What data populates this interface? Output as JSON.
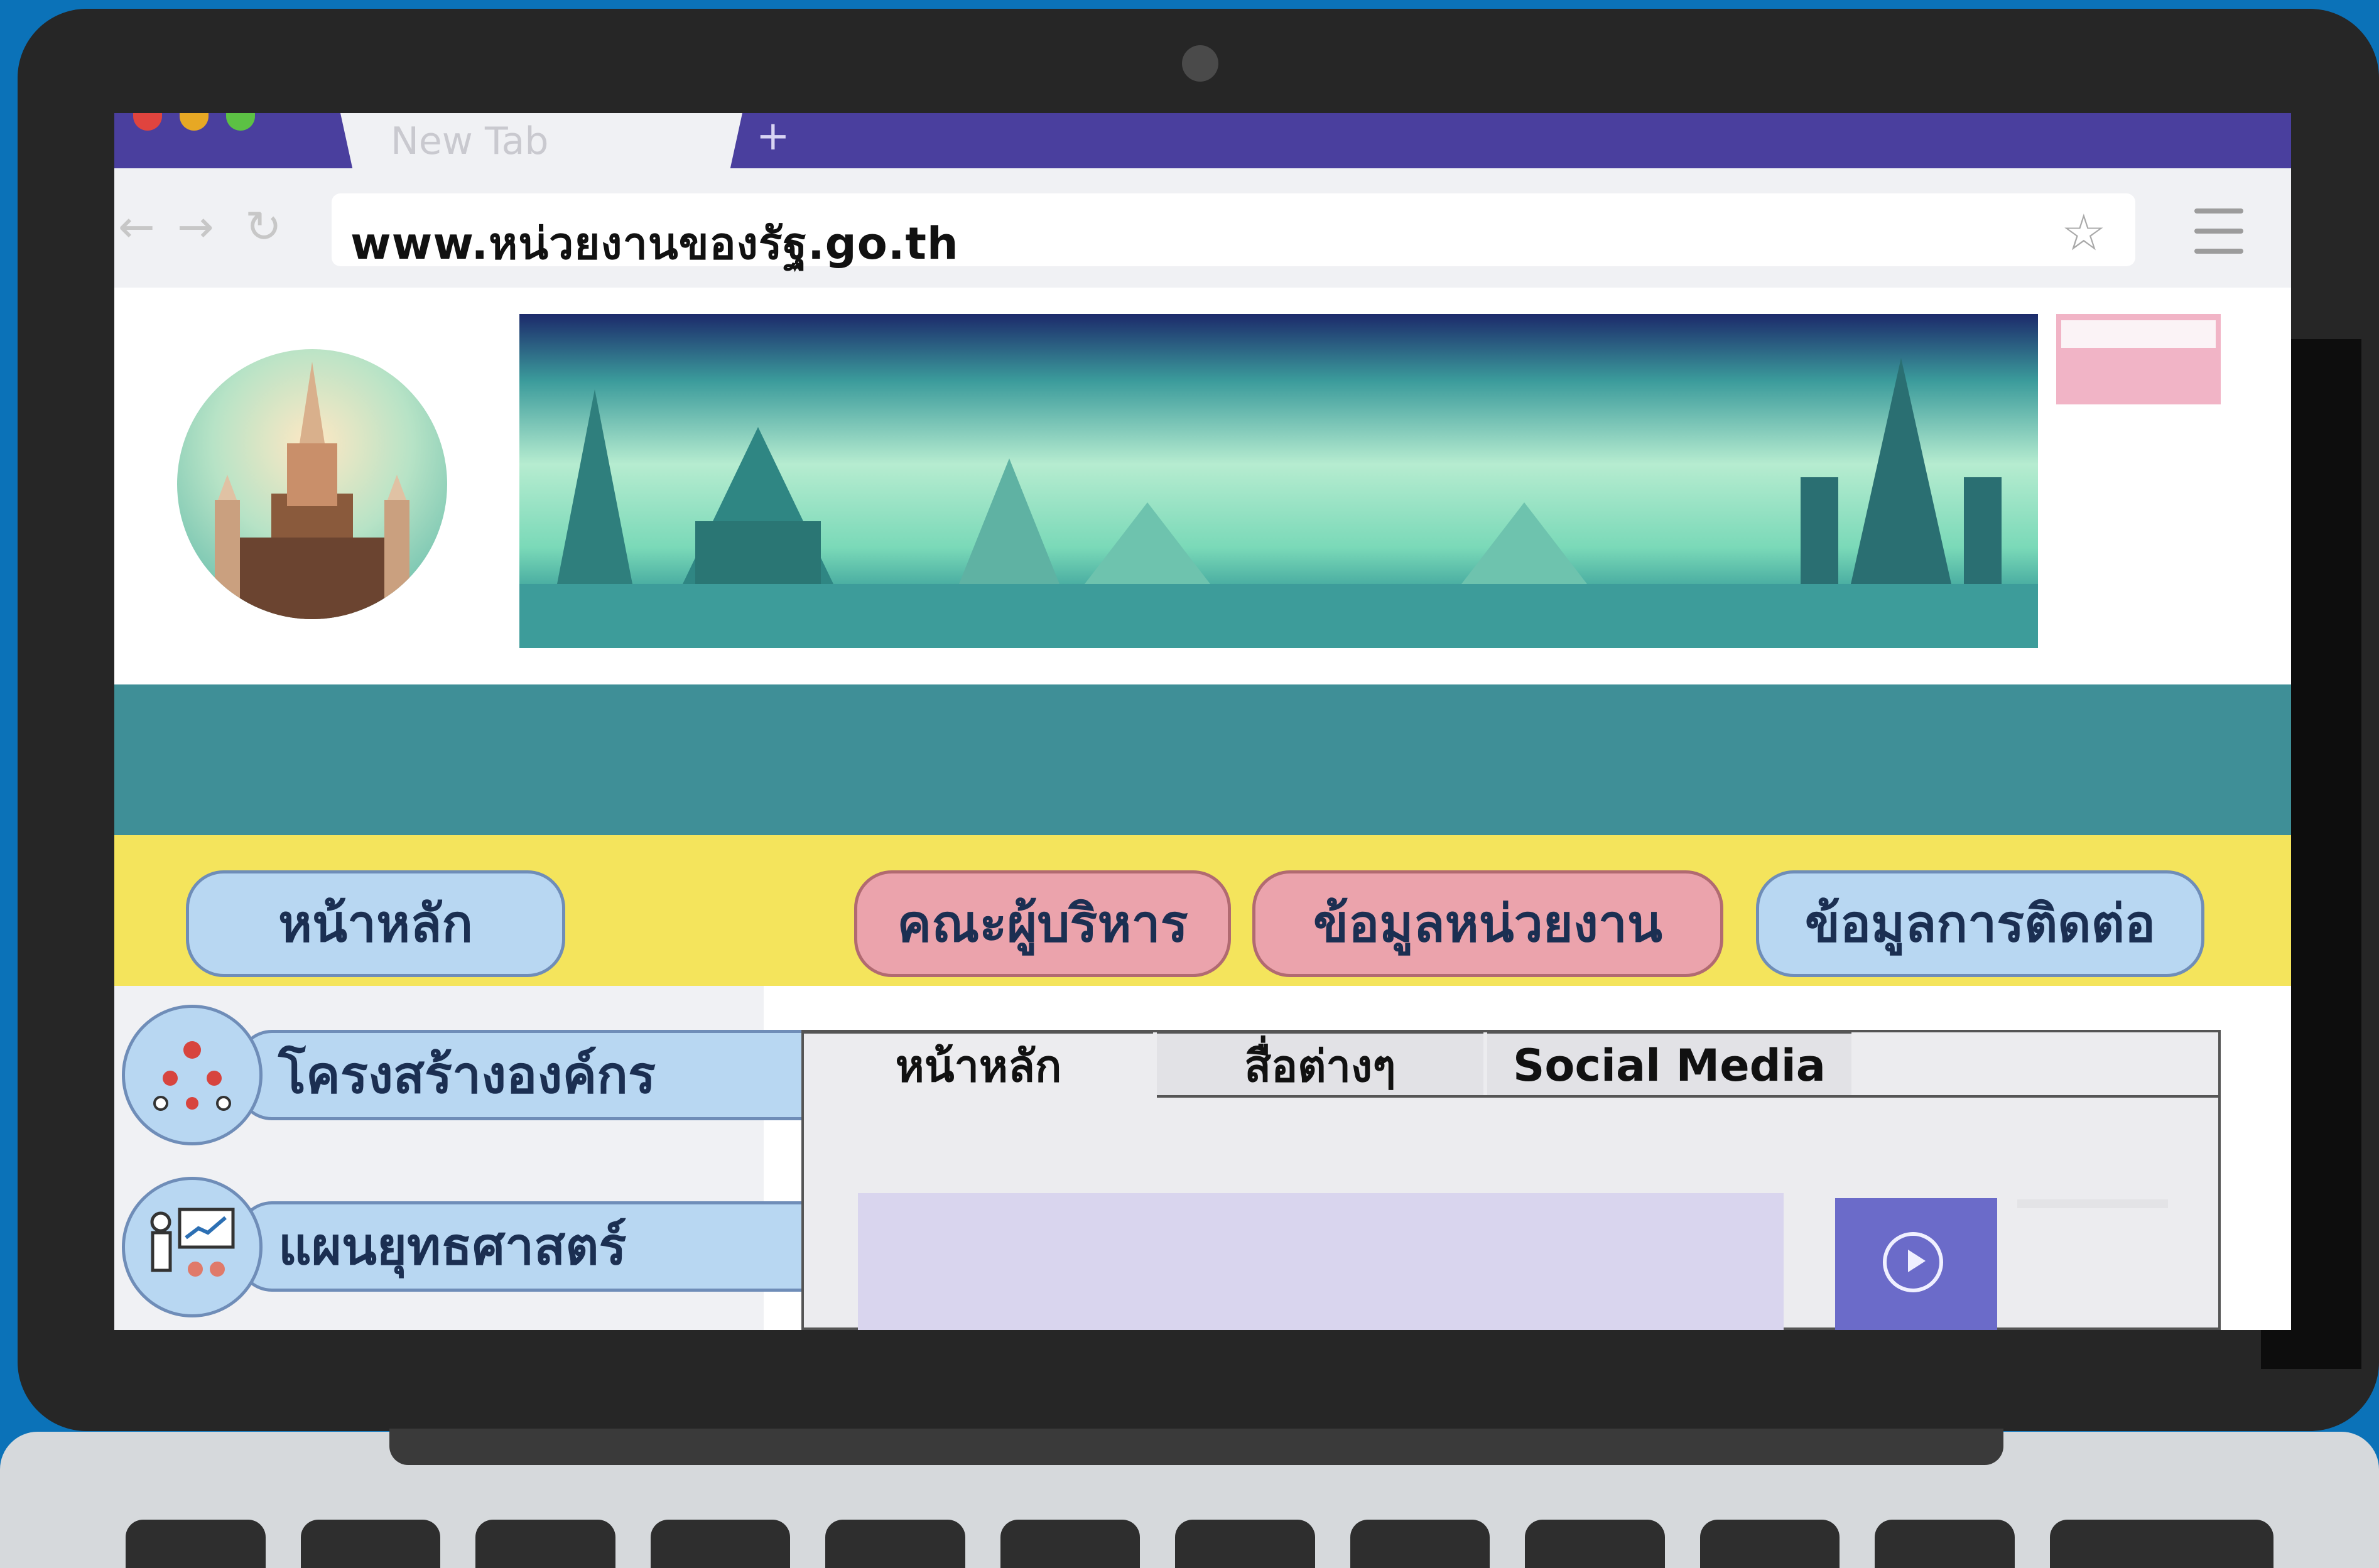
{
  "browser": {
    "tab_title": "New Tab",
    "new_tab_symbol": "+",
    "back_icon": "←",
    "forward_icon": "→",
    "reload_icon": "↻",
    "url": "www.หน่วยงานของรัฐ.go.th",
    "bookmark_icon": "☆"
  },
  "colors": {
    "tabbar": "#4a3f9e",
    "teal_band": "#3f8f97",
    "nav_band": "#f4e45c",
    "pill_blue": "#b8d7f2",
    "pill_pink": "#eba3ac",
    "background": "#0b72b8"
  },
  "nav": {
    "home": "หน้าหลัก",
    "executives": "คณะผู้บริหาร",
    "agency_info": "ข้อมูลหน่วยงาน",
    "contact_info": "ข้อมูลการติดต่อ"
  },
  "sidebar": {
    "items": [
      {
        "label": "โครงสร้างองค์กร",
        "icon": "org-chart-icon"
      },
      {
        "label": "แผนยุทธศาสตร์",
        "icon": "presentation-icon"
      }
    ]
  },
  "tabs": [
    {
      "label": "หน้าหลัก"
    },
    {
      "label": "สื่อต่างๆ"
    },
    {
      "label": "Social Media"
    }
  ]
}
